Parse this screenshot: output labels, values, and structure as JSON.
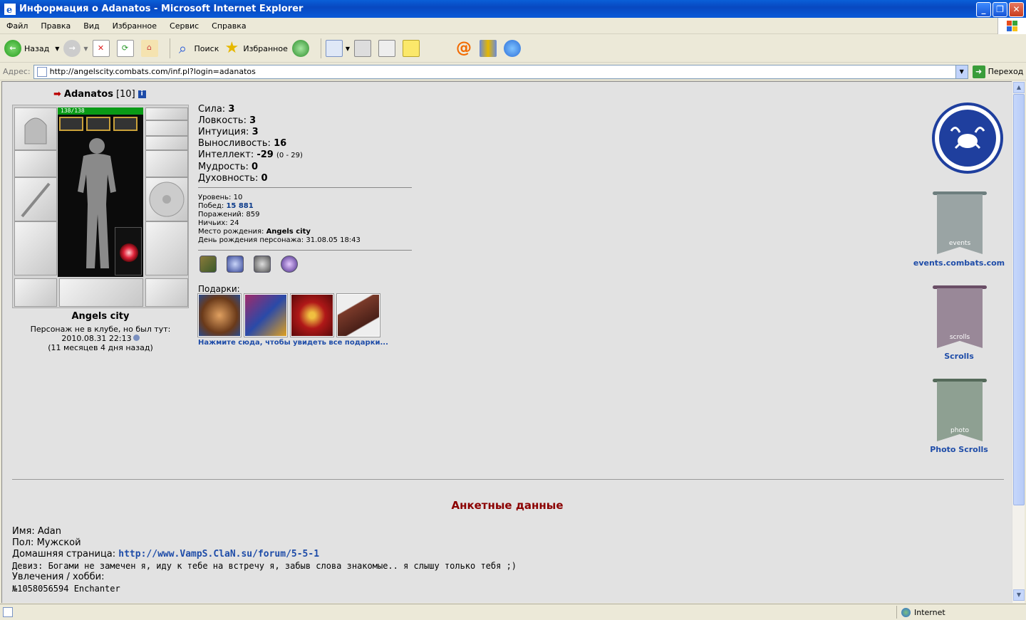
{
  "window": {
    "title": "Информация о Adanatos - Microsoft Internet Explorer"
  },
  "menu": [
    "Файл",
    "Правка",
    "Вид",
    "Избранное",
    "Сервис",
    "Справка"
  ],
  "toolbar": {
    "back": "Назад",
    "search": "Поиск",
    "favorites": "Избранное"
  },
  "address": {
    "label": "Адрес:",
    "url": "http://angelscity.combats.com/inf.pl?login=adanatos",
    "go": "Переход"
  },
  "status": {
    "zone": "Internet"
  },
  "character": {
    "name": "Adanatos",
    "level": "[10]",
    "hp": "138/138",
    "city": "Angels city",
    "club_note": "Персонаж не в клубе, но был тут:",
    "last_seen": "2010.08.31 22:13",
    "ago": "(11 месяцев 4 дня назад)"
  },
  "stats": [
    {
      "label": "Сила:",
      "value": "3",
      "extra": ""
    },
    {
      "label": "Ловкость:",
      "value": "3",
      "extra": ""
    },
    {
      "label": "Интуиция:",
      "value": "3",
      "extra": ""
    },
    {
      "label": "Выносливость:",
      "value": "16",
      "extra": ""
    },
    {
      "label": "Интеллект:",
      "value": "-29",
      "extra": "(0 - 29)"
    },
    {
      "label": "Мудрость:",
      "value": "0",
      "extra": ""
    },
    {
      "label": "Духовность:",
      "value": "0",
      "extra": ""
    }
  ],
  "info": {
    "level_label": "Уровень:",
    "level": "10",
    "wins_label": "Побед:",
    "wins": "15 881",
    "losses_label": "Поражений:",
    "losses": "859",
    "draws_label": "Ничьих:",
    "draws": "24",
    "birthplace_label": "Место рождения:",
    "birthplace": "Angels city",
    "birthday_label": "День рождения персонажа:",
    "birthday": "31.08.05 18:43"
  },
  "gifts": {
    "label": "Подарки:",
    "link": "Нажмите сюда, чтобы увидеть все подарки..."
  },
  "sidebar": {
    "events_banner": "events",
    "events_label": "events.combats.com",
    "scrolls_banner": "scrolls",
    "scrolls_label": "Scrolls",
    "photo_banner": "photo",
    "photo_label": "Photo Scrolls"
  },
  "anketa": {
    "title": "Анкетные данные",
    "name_label": "Имя:",
    "name": "Adan",
    "gender_label": "Пол:",
    "gender": "Мужской",
    "home_label": "Домашняя страница:",
    "home": "http://www.VampS.ClaN.su/forum/5-5-1",
    "motto_label": "Девиз:",
    "motto": "Богами не замечен я, иду к тебе на встречу я, забыв слова знакомые.. я слышу только тебя ;)",
    "hobby_label": "Увлечения / хобби:",
    "hobby": "№1058056594 Enchanter"
  },
  "colors": {
    "title_bar": "#0a5fd8",
    "page_bg": "#e2e2e2",
    "link": "#1e4ca8",
    "heading": "#8b0000",
    "hp": "#0a9a16"
  }
}
